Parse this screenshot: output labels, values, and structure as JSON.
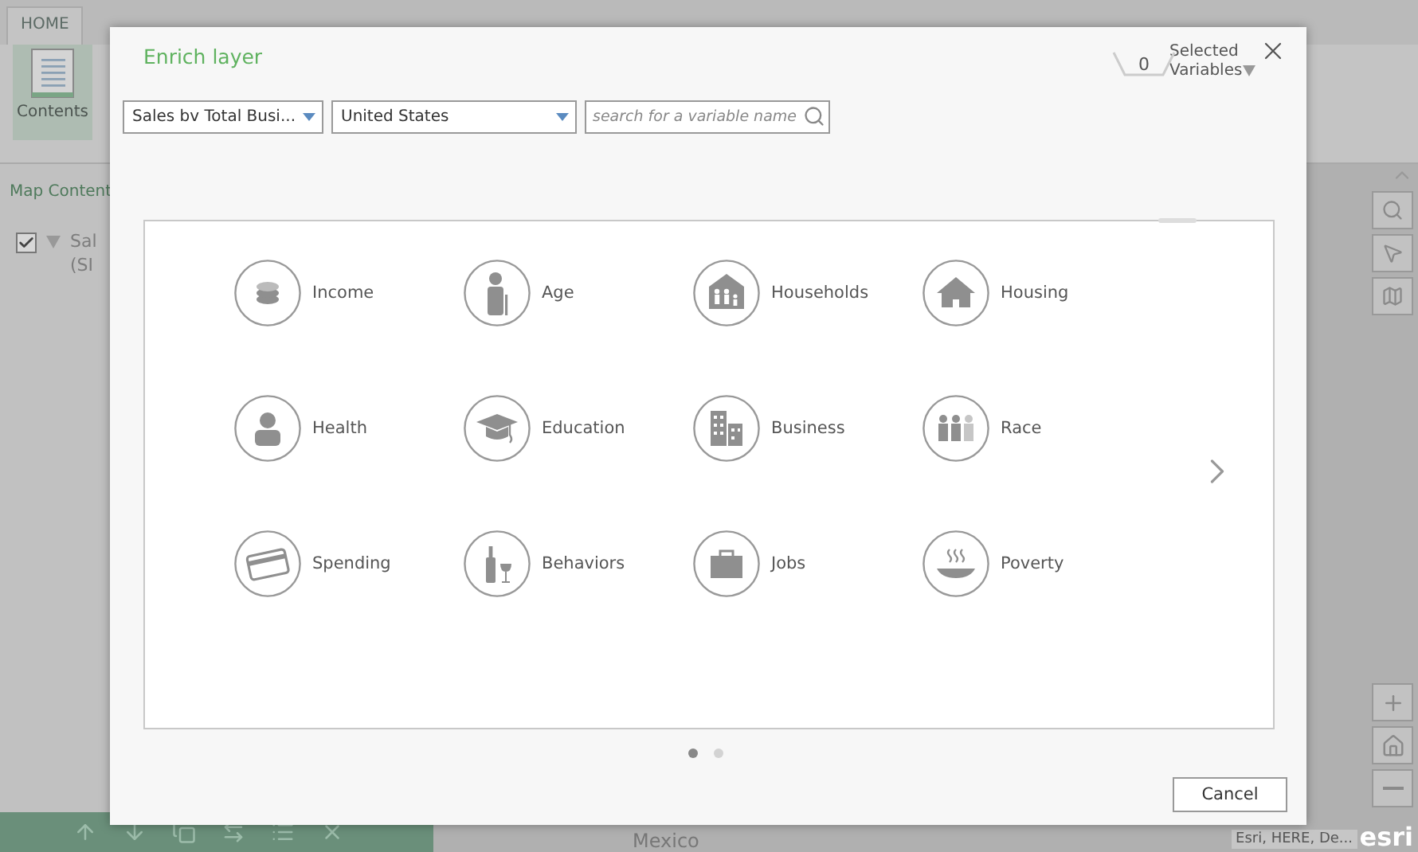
{
  "app": {
    "tabs": [
      {
        "label": "HOME",
        "selected": true
      }
    ],
    "ribbon": [
      {
        "label": "Contents",
        "selected": true
      }
    ],
    "panel_title": "Map Content",
    "layers": [
      {
        "name": "Sal",
        "subtitle": "(SI",
        "checked": true,
        "expanded": true
      }
    ]
  },
  "map": {
    "label": "Mexico",
    "attribution": "Esri, HERE, De...",
    "logo": "esri"
  },
  "dialog": {
    "title": "Enrich layer",
    "selected_count": "0",
    "selected_label": "Selected Variables",
    "dropdowns": [
      {
        "value": "Sales bv Total Busi..."
      },
      {
        "value": "United States"
      }
    ],
    "search": {
      "placeholder": "search for a variable name"
    },
    "categories": [
      {
        "label": "Income",
        "kind": "income"
      },
      {
        "label": "Age",
        "kind": "age"
      },
      {
        "label": "Households",
        "kind": "households"
      },
      {
        "label": "Housing",
        "kind": "housing"
      },
      {
        "label": "Health",
        "kind": "health"
      },
      {
        "label": "Education",
        "kind": "education"
      },
      {
        "label": "Business",
        "kind": "business"
      },
      {
        "label": "Race",
        "kind": "race"
      },
      {
        "label": "Spending",
        "kind": "spending"
      },
      {
        "label": "Behaviors",
        "kind": "behaviors"
      },
      {
        "label": "Jobs",
        "kind": "jobs"
      },
      {
        "label": "Poverty",
        "kind": "poverty"
      }
    ],
    "pages": [
      {
        "selected": true
      },
      {
        "selected": false
      }
    ],
    "buttons": [
      "Cancel"
    ]
  }
}
